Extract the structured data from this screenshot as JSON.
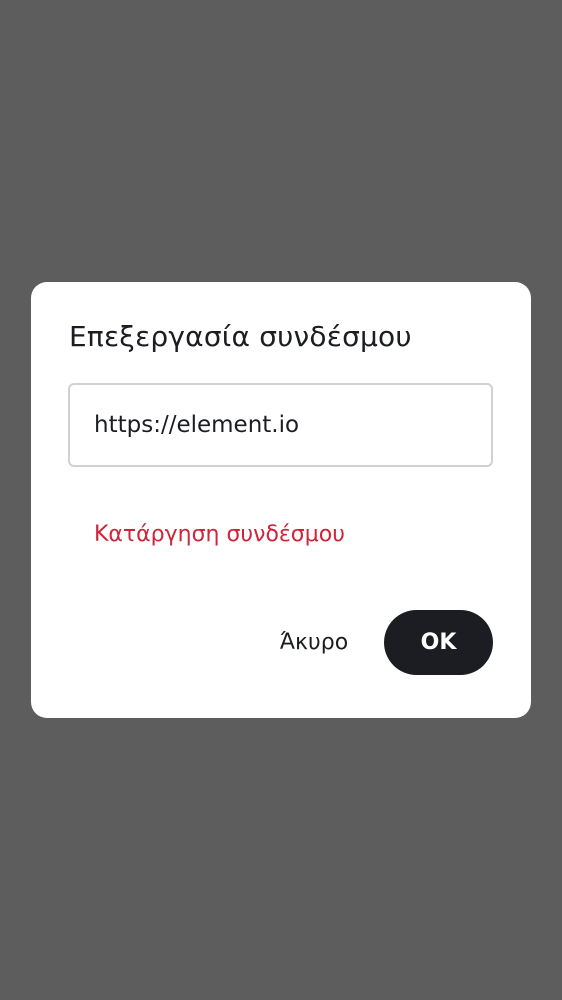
{
  "dialog": {
    "title": "Επεξεργασία συνδέσμου",
    "url_value": "https://element.io",
    "remove_link_label": "Κατάργηση συνδέσμου",
    "cancel_label": "Άκυρο",
    "ok_label": "OK"
  },
  "colors": {
    "scrim": "#5d5d5d",
    "dialog_background": "#ffffff",
    "text_primary": "#1b1d22",
    "destructive": "#d0243a",
    "field_border": "#cfd1d4",
    "primary_button": "#1b1d22"
  }
}
